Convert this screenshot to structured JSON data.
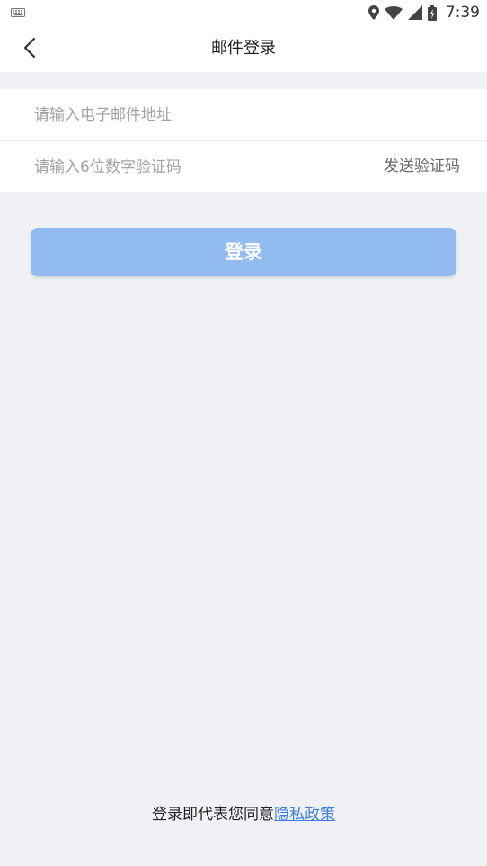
{
  "status_bar": {
    "time": "7:39",
    "icons": [
      "keyboard-icon",
      "location-icon",
      "wifi-icon",
      "cell-signal-icon",
      "battery-charging-icon"
    ]
  },
  "header": {
    "back_icon": "chevron-left-icon",
    "title": "邮件登录"
  },
  "form": {
    "email": {
      "value": "",
      "placeholder": "请输入电子邮件地址"
    },
    "code": {
      "value": "",
      "placeholder": "请输入6位数字验证码"
    },
    "send_code_label": "发送验证码"
  },
  "login_button": {
    "label": "登录",
    "color": "#92bbf2"
  },
  "agreement": {
    "text": "登录即代表您同意",
    "link_label": "隐私政策",
    "link_color": "#3b7fe6"
  },
  "colors": {
    "background": "#f0f1f5",
    "surface": "#ffffff"
  }
}
